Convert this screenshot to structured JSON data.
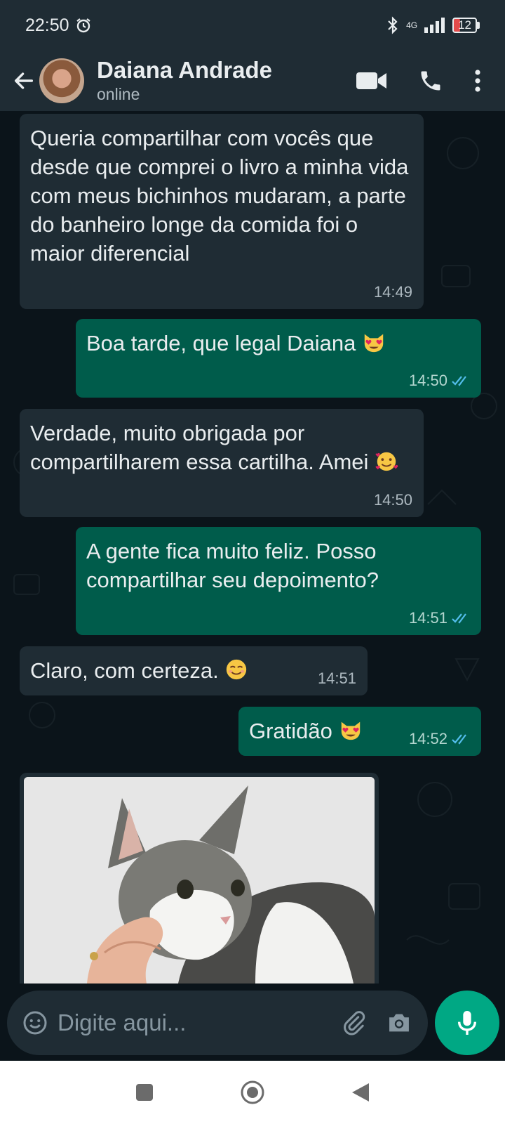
{
  "status_bar": {
    "time": "22:50",
    "network": "4G",
    "battery": "12"
  },
  "header": {
    "contact_name": "Daiana Andrade",
    "presence": "online"
  },
  "messages": [
    {
      "dir": "in",
      "text": "Queria compartilhar com vocês que desde que comprei o livro a minha vida com meus bichinhos mudaram, a parte do banheiro longe da comida foi o maior diferencial",
      "time": "14:49"
    },
    {
      "dir": "out",
      "text": "Boa tarde, que legal Daiana",
      "emoji": "heart-eyes-cat",
      "time": "14:50",
      "status": "read"
    },
    {
      "dir": "in",
      "text": "Verdade, muito obrigada por compartilharem essa cartilha. Amei",
      "emoji": "smiling-face-with-hearts",
      "time": "14:50"
    },
    {
      "dir": "out",
      "text": "A gente fica muito feliz. Posso compartilhar seu depoimento?",
      "time": "14:51",
      "status": "read"
    },
    {
      "dir": "in",
      "text": "Claro, com certeza.",
      "emoji": "smiling-face",
      "time": "14:51"
    },
    {
      "dir": "out",
      "text": "Gratidão",
      "emoji": "heart-eyes-cat",
      "time": "14:52",
      "status": "read"
    },
    {
      "dir": "in",
      "type": "image",
      "subject": "cat-photo"
    }
  ],
  "composer": {
    "placeholder": "Digite aqui..."
  },
  "colors": {
    "header_bg": "#1f2c34",
    "chat_bg": "#0b141a",
    "incoming_bubble": "#1f2c34",
    "outgoing_bubble": "#005c4b",
    "read_ticks": "#53bdeb",
    "mic_button": "#00a884"
  }
}
